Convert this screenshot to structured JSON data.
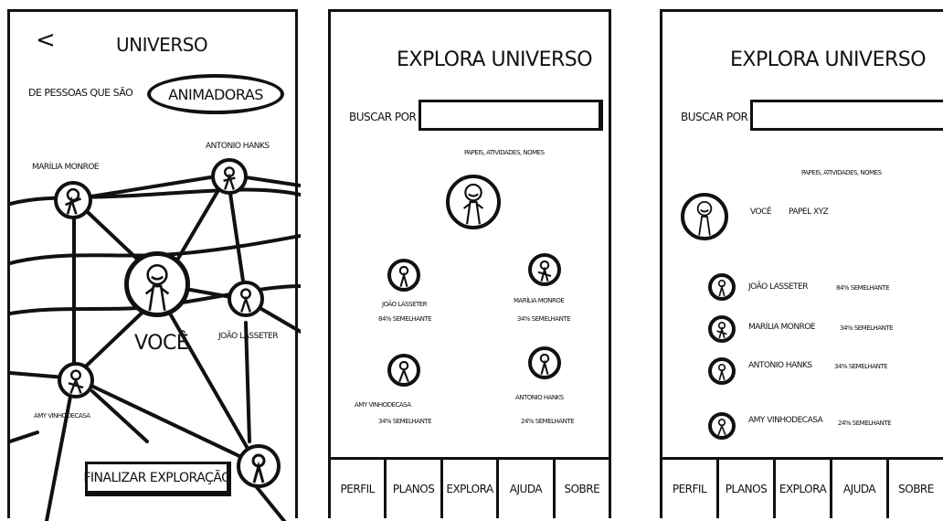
{
  "screen1": {
    "back_icon": "chevron-left-icon",
    "back_label": "<",
    "title": "UNIVERSO",
    "filter_prefix": "DE PESSOAS QUE SÃO",
    "filter_value": "ANIMADORAS",
    "nodes": {
      "marilia": "MARÍLIA MONROE",
      "antonio": "ANTONIO HANKS",
      "voce": "VOCÊ",
      "joao": "JOÃO LASSETER",
      "amy": "AMY VINHODECASA"
    },
    "finish_button": "FINALIZAR EXPLORAÇÃO"
  },
  "screen2": {
    "title": "EXPLORA UNIVERSO",
    "search_label": "BUSCAR POR",
    "search_hint": "PAPEIS, ATIVIDADES, NOMES",
    "people": [
      {
        "name": "JOÃO LASSETER",
        "similarity": "84% SEMELHANTE"
      },
      {
        "name": "MARÍLIA MONROE",
        "similarity": "34% SEMELHANTE"
      },
      {
        "name": "AMY VINHODECASA",
        "similarity": "34% SEMELHANTE"
      },
      {
        "name": "ANTONIO HANKS",
        "similarity": "24% SEMELHANTE"
      }
    ],
    "tabs": [
      "PERFIL",
      "PLANOS",
      "EXPLORA",
      "AJUDA",
      "SOBRE"
    ]
  },
  "screen3": {
    "title": "EXPLORA UNIVERSO",
    "search_label": "BUSCAR POR",
    "search_hint": "PAPEIS, ATIVIDADES, NOMES",
    "you_label": "VOCÊ",
    "you_role": "PAPEL XYZ",
    "people": [
      {
        "name": "JOÃO LASSETER",
        "similarity": "84% SEMELHANTE"
      },
      {
        "name": "MARÍLIA MONROE",
        "similarity": "34% SEMELHANTE"
      },
      {
        "name": "ANTONIO HANKS",
        "similarity": "34% SEMELHANTE"
      },
      {
        "name": "AMY VINHODECASA",
        "similarity": "24% SEMELHANTE"
      }
    ],
    "tabs": [
      "PERFIL",
      "PLANOS",
      "EXPLORA",
      "AJUDA",
      "SOBRE"
    ]
  },
  "colors": {
    "ink": "#111111",
    "paper": "#ffffff"
  }
}
